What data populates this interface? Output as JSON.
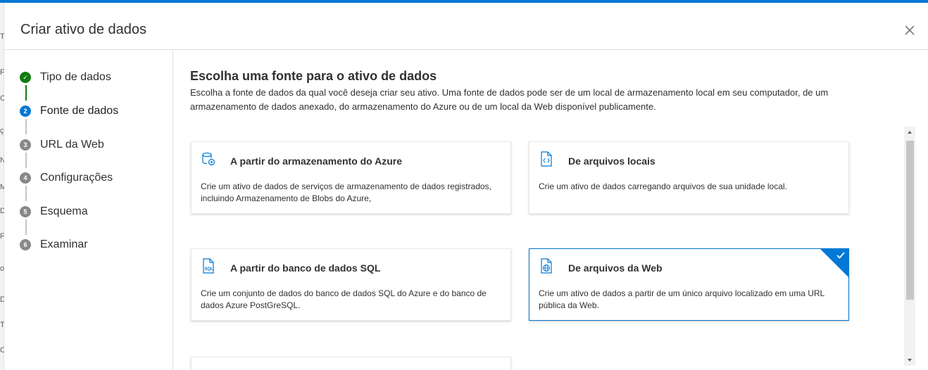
{
  "background_letters": [
    "T",
    "F",
    "C",
    "ç",
    "N",
    "M",
    "D",
    "F",
    "o",
    "D",
    "T",
    "C"
  ],
  "dialog": {
    "title": "Criar ativo de dados"
  },
  "steps": [
    {
      "label": "Tipo de dados",
      "marker": "✓",
      "state": "done"
    },
    {
      "label": "Fonte de dados",
      "marker": "2",
      "state": "current"
    },
    {
      "label": "URL da Web",
      "marker": "3",
      "state": "pending"
    },
    {
      "label": "Configurações",
      "marker": "4",
      "state": "pending"
    },
    {
      "label": "Esquema",
      "marker": "5",
      "state": "pending"
    },
    {
      "label": "Examinar",
      "marker": "6",
      "state": "pending"
    }
  ],
  "main": {
    "title": "Escolha uma fonte para o ativo de dados",
    "description": "Escolha a fonte de dados da qual você deseja criar seu ativo. Uma fonte de dados pode ser de um local de armazenamento local em seu computador, de um armazenamento de dados anexado, do armazenamento do Azure ou de um local da Web disponível publicamente."
  },
  "cards": [
    {
      "icon": "azure-storage-icon",
      "title": "A partir do armazenamento do Azure",
      "desc": "Crie um ativo de dados de serviços de armazenamento de dados registrados, incluindo Armazenamento de Blobs do Azure,",
      "selected": false
    },
    {
      "icon": "local-file-icon",
      "title": "De arquivos locais",
      "desc": "Crie um ativo de dados carregando arquivos de sua unidade local.",
      "selected": false
    },
    {
      "icon": "sql-file-icon",
      "title": "A partir do banco de dados SQL",
      "desc": "Crie um conjunto de dados do banco de dados SQL do Azure e do banco de dados Azure PostGreSQL.",
      "selected": false
    },
    {
      "icon": "web-file-icon",
      "title": "De arquivos da Web",
      "desc": "Crie um ativo de dados a partir de um único arquivo localizado em uma URL pública da Web.",
      "selected": true
    }
  ],
  "colors": {
    "accent": "#0078d4",
    "done": "#107c10",
    "pending": "#8a8886"
  }
}
